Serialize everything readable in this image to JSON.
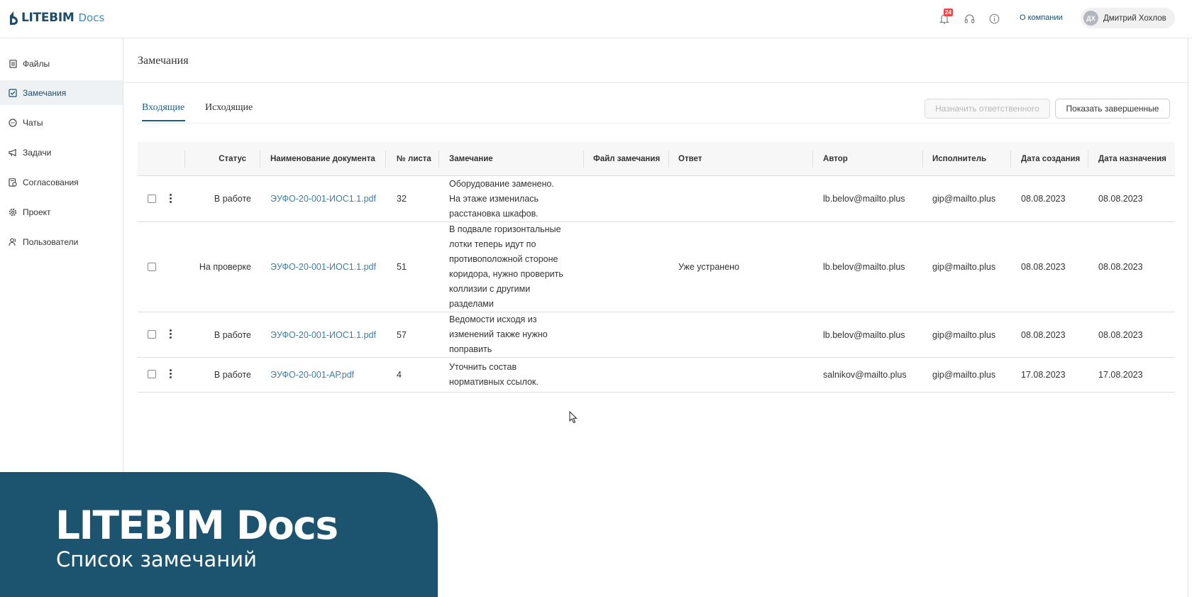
{
  "header": {
    "logo_text": "LITEBIM",
    "logo_sub": "Docs",
    "notifications_count": "24",
    "about_label": "О компании",
    "user_initials": "ДХ",
    "user_name": "Дмитрий Хохлов"
  },
  "sidebar": {
    "items": [
      {
        "label": "Файлы",
        "icon": "file-icon"
      },
      {
        "label": "Замечания",
        "icon": "checkbox-icon"
      },
      {
        "label": "Чаты",
        "icon": "chat-icon"
      },
      {
        "label": "Задачи",
        "icon": "megaphone-icon"
      },
      {
        "label": "Согласования",
        "icon": "document-check-icon"
      },
      {
        "label": "Проект",
        "icon": "gear-icon"
      },
      {
        "label": "Пользователи",
        "icon": "users-icon"
      }
    ],
    "active_index": 1
  },
  "main": {
    "title": "Замечания",
    "tabs": [
      {
        "label": "Входящие",
        "active": true
      },
      {
        "label": "Исходящие",
        "active": false
      }
    ],
    "assign_button": "Назначить ответственного",
    "show_completed_button": "Показать завершенные"
  },
  "table": {
    "columns": [
      "Статус",
      "Наименование документа",
      "№ листа",
      "Замечание",
      "Файл замечания",
      "Ответ",
      "Автор",
      "Исполнитель",
      "Дата создания",
      "Дата назначения"
    ],
    "rows": [
      {
        "status": "В работе",
        "document": "ЭУФО-20-001-ИОС1.1.pdf",
        "sheet": "32",
        "remark": " Оборудование заменено.\nНа этаже изменилась\nрасстановка шкафов.",
        "remark_file": "",
        "answer": "",
        "author": "lb.belov@mailto.plus",
        "assignee": "gip@mailto.plus",
        "created": "08.08.2023",
        "assigned": "08.08.2023",
        "has_menu": true
      },
      {
        "status": "На проверке",
        "document": "ЭУФО-20-001-ИОС1.1.pdf",
        "sheet": "51",
        "remark": " В подвале горизонтальные\nлотки теперь идут по\nпротивоположной стороне\nкоридора, нужно проверить\nколлизии с другими\nразделами",
        "remark_file": "",
        "answer": "Уже устранено",
        "author": "lb.belov@mailto.plus",
        "assignee": "gip@mailto.plus",
        "created": "08.08.2023",
        "assigned": "08.08.2023",
        "has_menu": false
      },
      {
        "status": "В работе",
        "document": "ЭУФО-20-001-ИОС1.1.pdf",
        "sheet": "57",
        "remark": " Ведомости исходя из\nизменений также нужно\nпоправить",
        "remark_file": "",
        "answer": "",
        "author": "lb.belov@mailto.plus",
        "assignee": "gip@mailto.plus",
        "created": "08.08.2023",
        "assigned": "08.08.2023",
        "has_menu": true
      },
      {
        "status": "В работе",
        "document": "ЭУФО-20-001-АР.pdf",
        "sheet": "4",
        "remark": " Уточнить состав\nнормативных ссылок.",
        "remark_file": "",
        "answer": "",
        "author": "salnikov@mailto.plus",
        "assignee": "gip@mailto.plus",
        "created": "17.08.2023",
        "assigned": "17.08.2023",
        "has_menu": true
      }
    ]
  },
  "banner": {
    "title": "LITEBIM Docs",
    "subtitle": "Список замечаний"
  },
  "colors": {
    "brand_dark": "#1d4d6b",
    "brand_light": "#3d8bbd",
    "link": "#3a7ea8",
    "banner_bg": "#1c5470",
    "badge": "#e84a4a"
  }
}
